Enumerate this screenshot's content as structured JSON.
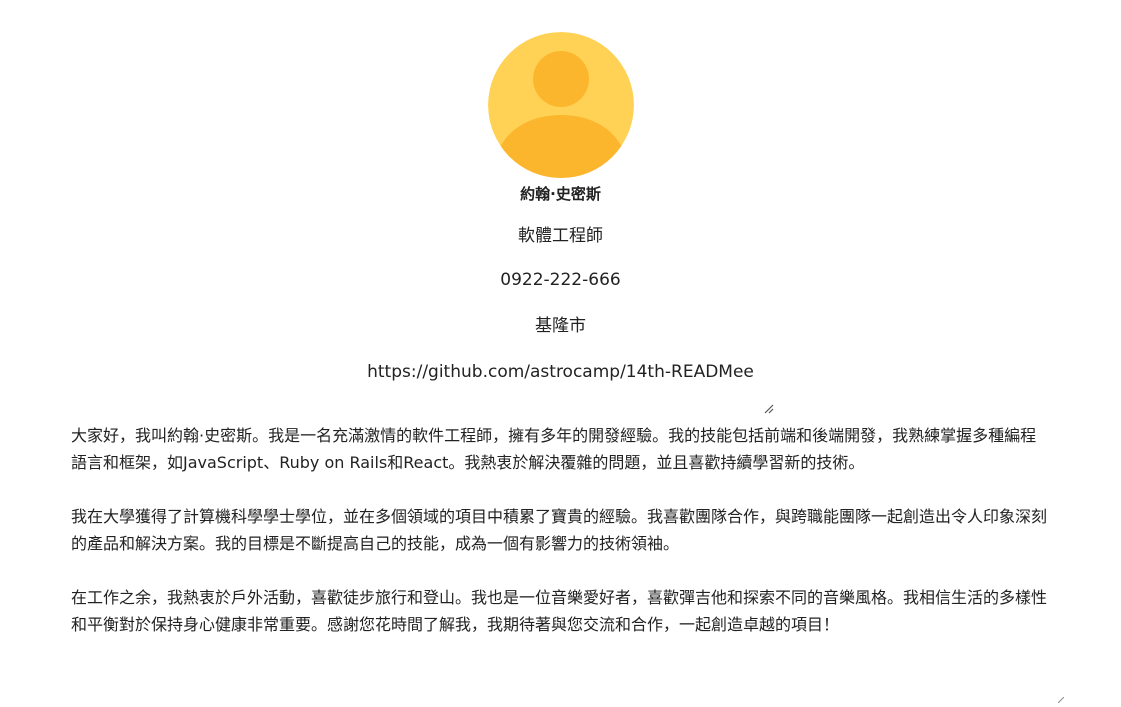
{
  "profile": {
    "name": "約翰·史密斯",
    "title": "軟體工程師",
    "phone": "0922-222-666",
    "city": "基隆市",
    "github_url": "https://github.com/astrocamp/14th-READMee",
    "avatar_icon": "user-avatar-icon",
    "avatar_colors": {
      "background": "#FFD256",
      "figure": "#FBB62E"
    }
  },
  "bio": {
    "paragraphs": [
      "大家好，我叫約翰·史密斯。我是一名充滿激情的軟件工程師，擁有多年的開發經驗。我的技能包括前端和後端開發，我熟練掌握多種編程語言和框架，如JavaScript、Ruby on Rails和React。我熱衷於解決覆雜的問題，並且喜歡持續學習新的技術。",
      "我在大學獲得了計算機科學學士學位，並在多個領域的項目中積累了寶貴的經驗。我喜歡團隊合作，與跨職能團隊一起創造出令人印象深刻的產品和解決方案。我的目標是不斷提高自己的技能，成為一個有影響力的技術領袖。",
      "在工作之余，我熱衷於戶外活動，喜歡徒步旅行和登山。我也是一位音樂愛好者，喜歡彈吉他和探索不同的音樂風格。我相信生活的多樣性和平衡對於保持身心健康非常重要。感謝您花時間了解我，我期待著與您交流和合作，一起創造卓越的項目！"
    ]
  },
  "ui": {
    "resize_icon": "resize-handle-icon"
  }
}
